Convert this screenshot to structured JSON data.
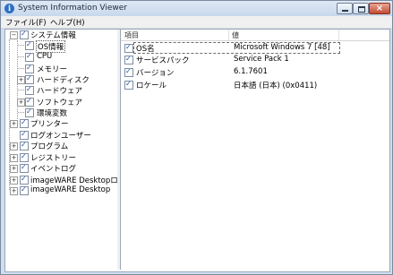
{
  "window": {
    "title": "System Information Viewer",
    "app_icon_glyph": "i"
  },
  "menu": [
    {
      "label": "ファイル(F)"
    },
    {
      "label": "ヘルプ(H)"
    }
  ],
  "tree": [
    {
      "label": "システム情報"
    },
    {
      "label": "OS情報"
    },
    {
      "label": "CPU"
    },
    {
      "label": "メモリー"
    },
    {
      "label": "ハードディスク"
    },
    {
      "label": "ハードウェア"
    },
    {
      "label": "ソフトウェア"
    },
    {
      "label": "環境変数"
    },
    {
      "label": "プリンター"
    },
    {
      "label": "ログオンユーザー"
    },
    {
      "label": "プログラム"
    },
    {
      "label": "レジストリー"
    },
    {
      "label": "イベントログ"
    },
    {
      "label": "imageWARE Desktopログフ"
    },
    {
      "label": "imageWARE Desktop"
    }
  ],
  "list": {
    "columns": [
      {
        "label": "項目"
      },
      {
        "label": "値"
      }
    ],
    "rows": [
      {
        "item": "OS名",
        "value": "Microsoft Windows 7 [48]"
      },
      {
        "item": "サービスパック",
        "value": "Service Pack 1"
      },
      {
        "item": "バージョン",
        "value": "6.1.7601"
      },
      {
        "item": "ロケール",
        "value": "日本語 (日本) (0x0411)"
      }
    ]
  }
}
